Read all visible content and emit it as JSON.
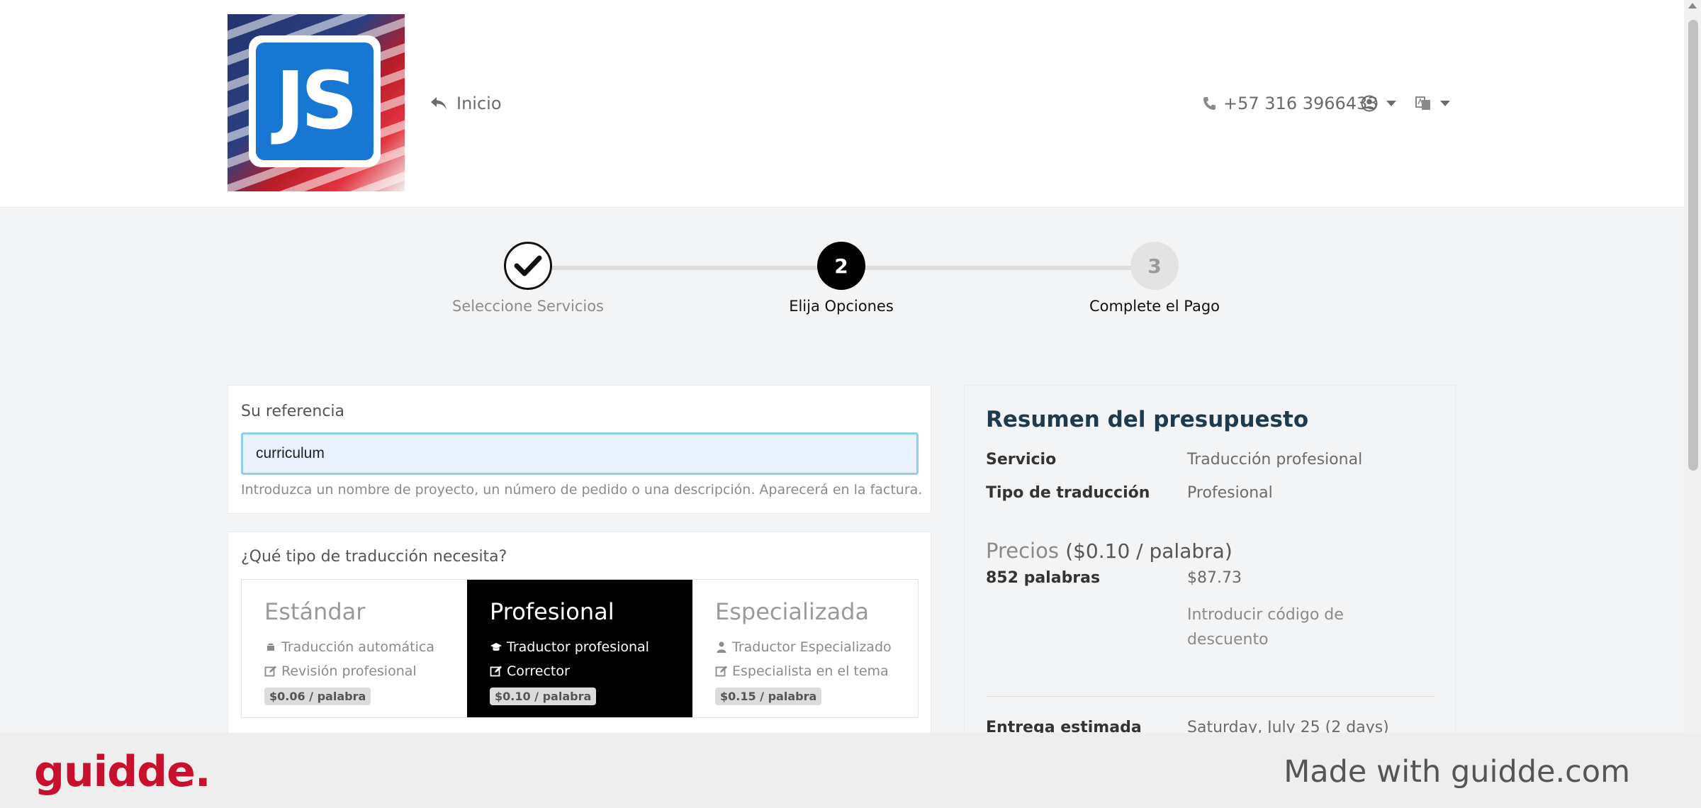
{
  "header": {
    "logo_text": "JS",
    "home_label": "Inicio",
    "phone": "+57 316 3966433"
  },
  "stepper": {
    "steps": [
      {
        "number": "",
        "label": "Seleccione Servicios",
        "state": "done"
      },
      {
        "number": "2",
        "label": "Elija Opciones",
        "state": "active"
      },
      {
        "number": "3",
        "label": "Complete el Pago",
        "state": "pending"
      }
    ]
  },
  "reference": {
    "label": "Su referencia",
    "value": "curriculum",
    "help": "Introduzca un nombre de proyecto, un número de pedido o una descripción. Aparecerá en la factura."
  },
  "translation_type": {
    "label": "¿Qué tipo de traducción necesita?",
    "options": [
      {
        "title": "Estándar",
        "feature1": "Traducción automática",
        "feature2": "Revisión profesional",
        "price": "$0.06 / palabra",
        "selected": false
      },
      {
        "title": "Profesional",
        "feature1": "Traductor profesional",
        "feature2": "Corrector",
        "price": "$0.10 / palabra",
        "selected": true
      },
      {
        "title": "Especializada",
        "feature1": "Traductor Especializado",
        "feature2": "Especialista en el tema",
        "price": "$0.15 / palabra",
        "selected": false
      }
    ]
  },
  "summary": {
    "title": "Resumen del presupuesto",
    "service_key": "Servicio",
    "service_value": "Traducción profesional",
    "type_key": "Tipo de traducción",
    "type_value": "Profesional",
    "prices_label": "Precios",
    "prices_rate": "($0.10 / palabra)",
    "words_key": "852 palabras",
    "words_value": "$87.73",
    "discount_link": "Introducir código de descuento",
    "delivery_key": "Entrega estimada",
    "delivery_value": "Saturday, July 25 (2 days)"
  },
  "footer": {
    "brand": "guidde.",
    "made_with": "Made with guidde.com"
  },
  "colors": {
    "brand_red": "#c8102e",
    "selected_option_bg": "#000000",
    "input_focus_border": "#8fcde8",
    "summary_title": "#1e3b4d"
  }
}
